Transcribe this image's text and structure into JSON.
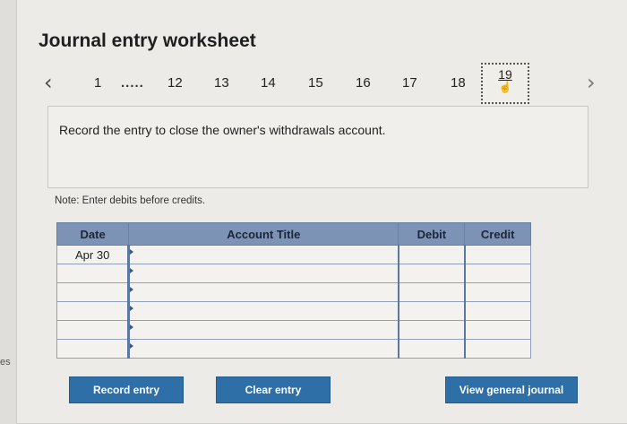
{
  "edge_text": "es",
  "worksheet": {
    "title": "Journal entry worksheet",
    "nav": {
      "prev_icon": "chevron-left",
      "next_icon": "chevron-right",
      "steps": [
        "1",
        "12",
        "13",
        "14",
        "15",
        "16",
        "17",
        "18"
      ],
      "ellipsis": ".....",
      "active_step": "19"
    },
    "prompt": "Record the entry to close the owner's withdrawals account.",
    "note": "Note: Enter debits before credits.",
    "table": {
      "headers": [
        "Date",
        "Account Title",
        "Debit",
        "Credit"
      ],
      "rows": [
        {
          "date": "Apr 30",
          "account": "",
          "debit": "",
          "credit": ""
        },
        {
          "date": "",
          "account": "",
          "debit": "",
          "credit": ""
        },
        {
          "date": "",
          "account": "",
          "debit": "",
          "credit": ""
        },
        {
          "date": "",
          "account": "",
          "debit": "",
          "credit": ""
        },
        {
          "date": "",
          "account": "",
          "debit": "",
          "credit": ""
        },
        {
          "date": "",
          "account": "",
          "debit": "",
          "credit": ""
        }
      ]
    },
    "buttons": {
      "record": "Record entry",
      "clear": "Clear entry",
      "view": "View general journal"
    }
  }
}
